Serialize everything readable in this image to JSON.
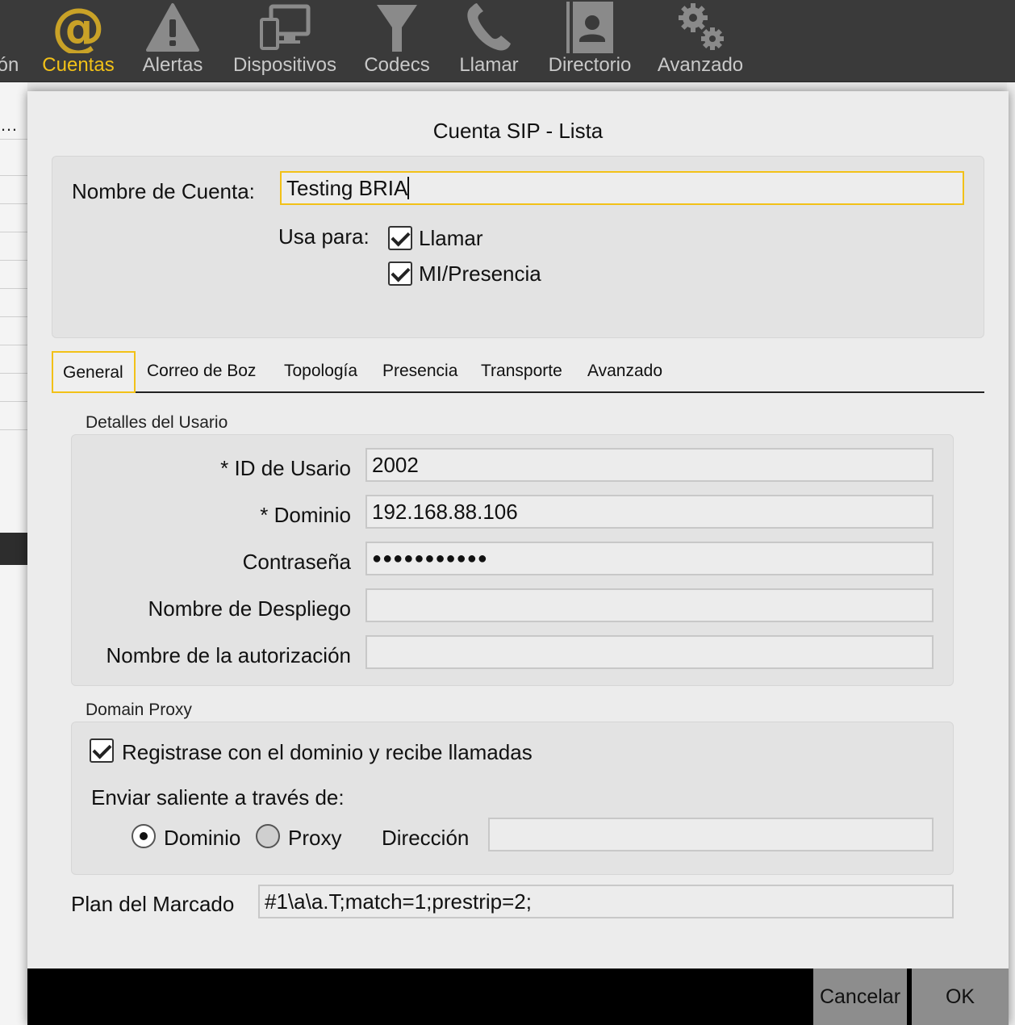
{
  "toolbar": {
    "items": [
      {
        "label": "ón",
        "icon": "truncated-icon"
      },
      {
        "label": "Cuentas",
        "icon": "at-sign-icon"
      },
      {
        "label": "Alertas",
        "icon": "warning-icon"
      },
      {
        "label": "Dispositivos",
        "icon": "devices-icon"
      },
      {
        "label": "Codecs",
        "icon": "funnel-icon"
      },
      {
        "label": "Llamar",
        "icon": "phone-icon"
      },
      {
        "label": "Directorio",
        "icon": "contact-book-icon"
      },
      {
        "label": "Avanzado",
        "icon": "gears-icon"
      }
    ],
    "active": "Cuentas",
    "accent_color": "#f2c118"
  },
  "background": {
    "left_row_text": "…"
  },
  "dialog": {
    "title": "Cuenta SIP - Lista",
    "account_name_label": "Nombre de Cuenta:",
    "account_name_value": "Testing BRIA",
    "use_for_label": "Usa para:",
    "use_for_options": [
      {
        "label": "Llamar",
        "checked": true
      },
      {
        "label": "MI/Presencia",
        "checked": true
      }
    ],
    "tabs": [
      "General",
      "Correo de Boz",
      "Topología",
      "Presencia",
      "Transporte",
      "Avanzado"
    ],
    "active_tab": "General",
    "user_details": {
      "title": "Detalles del Usario",
      "fields": [
        {
          "label": "* ID de Usario",
          "value": "2002"
        },
        {
          "label": "* Dominio",
          "value": "192.168.88.106"
        },
        {
          "label": "Contraseña",
          "value": "●●●●●●●●●●●"
        },
        {
          "label": "Nombre de Despliego",
          "value": ""
        },
        {
          "label": "Nombre de la autorización",
          "value": ""
        }
      ]
    },
    "domain_proxy": {
      "title": "Domain Proxy",
      "register_label": "Registrase con el dominio y recibe llamadas",
      "register_checked": true,
      "send_outbound_label": "Enviar saliente a través de:",
      "options": [
        {
          "label": "Dominio",
          "selected": true
        },
        {
          "label": "Proxy",
          "selected": false
        }
      ],
      "address_label": "Dirección",
      "address_value": ""
    },
    "dial_plan_label": "Plan del Marcado",
    "dial_plan_value": "#1\\a\\a.T;match=1;prestrip=2;",
    "buttons": {
      "cancel": "Cancelar",
      "ok": "OK"
    }
  }
}
